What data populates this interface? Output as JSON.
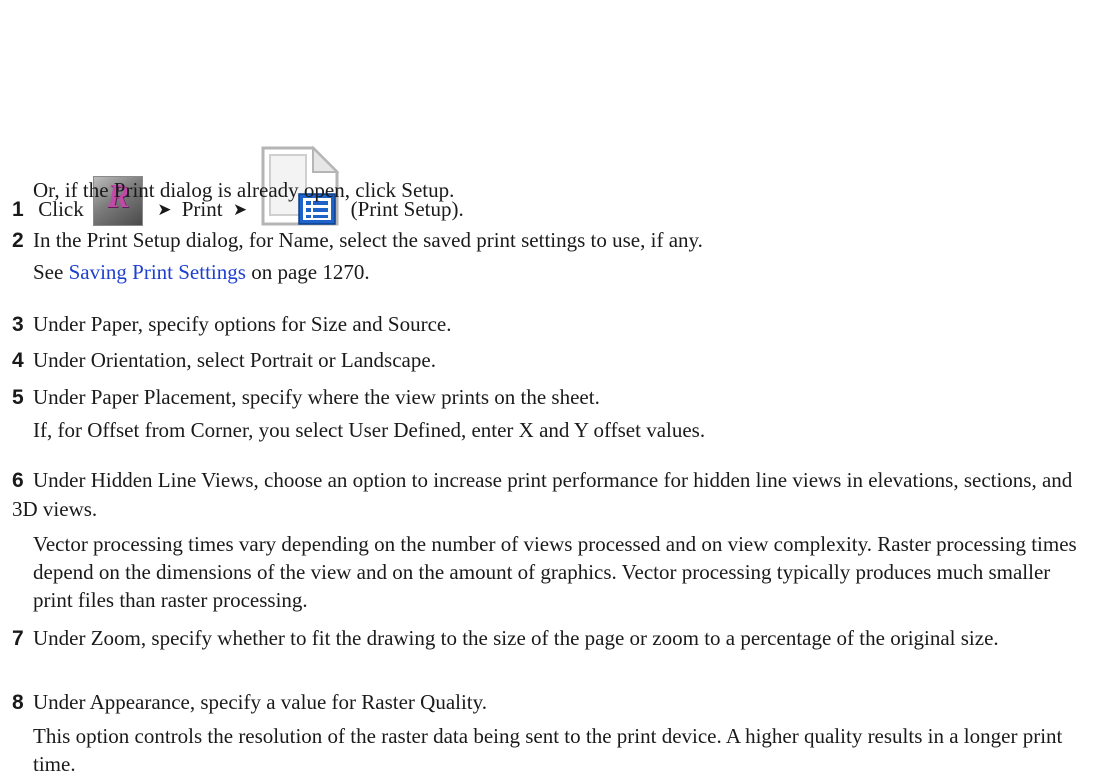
{
  "steps": [
    {
      "num": "1",
      "text_before": "Click",
      "arrow1": "➤",
      "print_label": "Print",
      "arrow2": "➤",
      "text_after": "(Print Setup).",
      "revit_icon": "application-menu-icon",
      "setup_icon": "print-setup-icon"
    },
    {
      "num": "2",
      "text": "In the Print Setup dialog, for Name, select the saved print settings to use, if any."
    },
    {
      "num": "3",
      "text": "Under Paper, specify options for Size and Source."
    },
    {
      "num": "4",
      "text": "Under Orientation, select Portrait or Landscape."
    },
    {
      "num": "5",
      "text": "Under Paper Placement, specify where the view prints on the sheet."
    },
    {
      "num": "6",
      "text": "Under Hidden Line Views, choose an option to increase print performance for hidden line views in elevations, sections, and 3D views."
    },
    {
      "num": "7",
      "text": "Under Zoom, specify whether to fit the drawing to the size of the page or zoom to a percentage of the original size."
    },
    {
      "num": "8",
      "text": "Under Appearance, specify a value for Raster Quality."
    }
  ],
  "notes": {
    "step1": "Or, if the Print dialog is already open, click Setup.",
    "step2_see": "See",
    "step2_link": "Saving Print Settings",
    "step2_page": "on page 1270.",
    "step5": "If, for Offset from Corner, you select User Defined, enter X and Y offset values.",
    "step6": "Vector processing times vary depending on the number of views processed and on view complexity. Raster processing times depend on the dimensions of the view and on the amount of graphics. Vector processing typically produces much smaller print files than raster processing.",
    "step8": "This option controls the resolution of the raster data being sent to the print device. A higher quality results in a longer print time."
  },
  "colors": {
    "link": "#1f3fcf",
    "text": "#1a1a1a"
  }
}
